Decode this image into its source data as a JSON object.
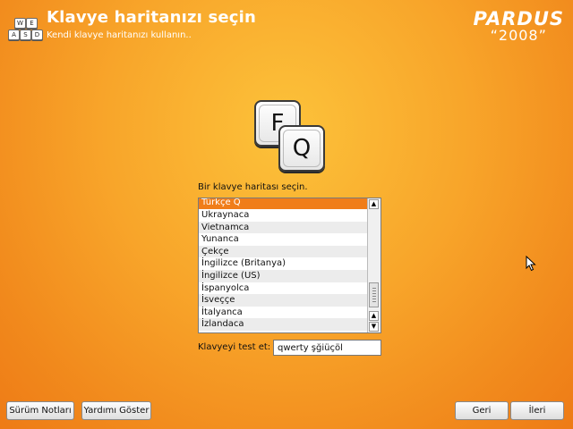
{
  "header": {
    "keys": [
      "W",
      "E",
      "A",
      "S",
      "D"
    ],
    "title": "Klavye haritanızı seçin",
    "subtitle": "Kendi klavye haritanızı kullanın..",
    "logo_brand": "PARDUS",
    "logo_year": "“2008”"
  },
  "illustration": {
    "key1": "F",
    "key2": "Q"
  },
  "main": {
    "prompt": "Bir klavye haritası seçin.",
    "layouts": [
      {
        "label": "Türkçe Q",
        "selected": true
      },
      {
        "label": "Ukraynaca"
      },
      {
        "label": "Vietnamca"
      },
      {
        "label": "Yunanca"
      },
      {
        "label": "Çekçe"
      },
      {
        "label": "İngilizce (Britanya)"
      },
      {
        "label": "İngilizce (US)"
      },
      {
        "label": "İspanyolca"
      },
      {
        "label": "İsveççe"
      },
      {
        "label": "İtalyanca"
      },
      {
        "label": "İzlandaca"
      }
    ],
    "test_label": "Klavyeyi test et:",
    "test_value": "qwerty şğiüçöl"
  },
  "footer": {
    "release_notes": "Sürüm Notları",
    "show_help": "Yardımı Göster",
    "back": "Geri",
    "next": "İleri"
  },
  "colors": {
    "accent": "#f07d19",
    "background": "#f8a52a"
  }
}
